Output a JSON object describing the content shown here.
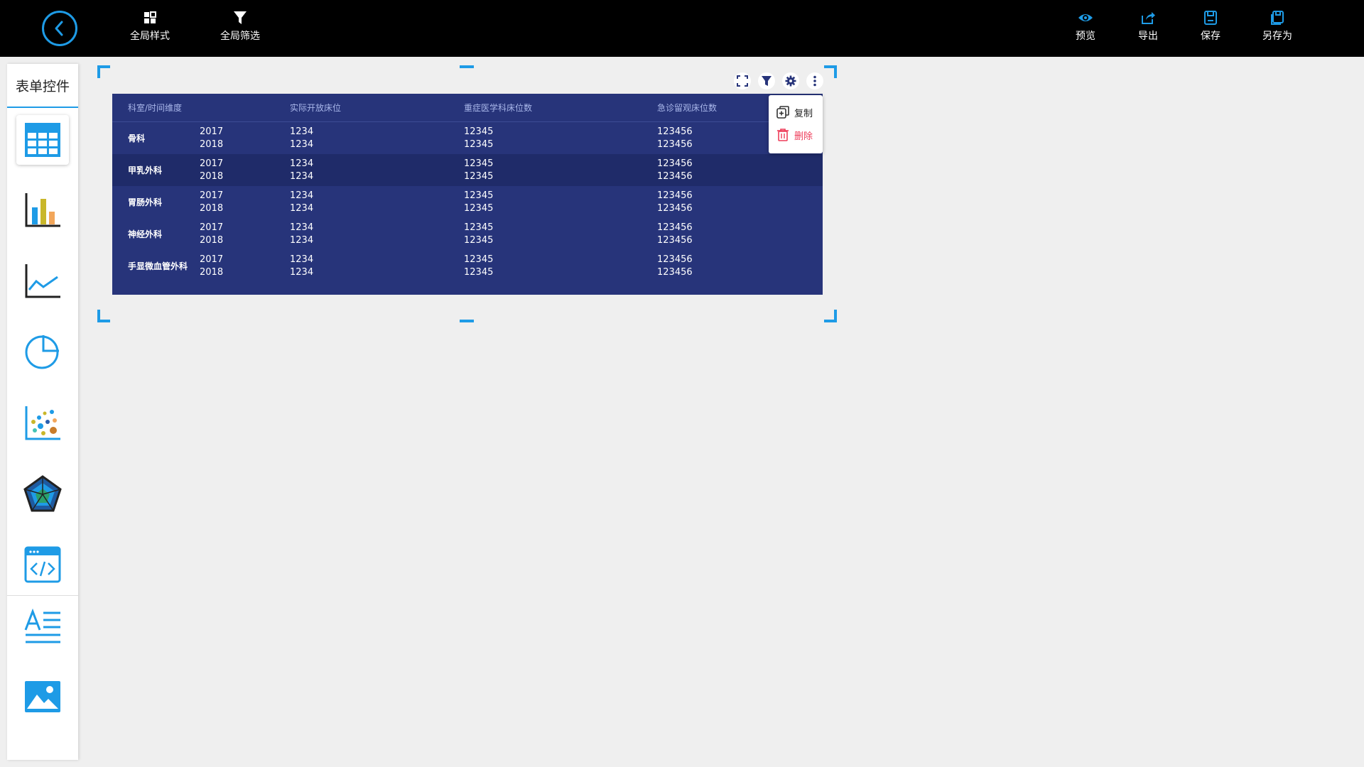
{
  "toolbar": {
    "left_tools": [
      {
        "label": "全局样式",
        "icon": "grid-icon"
      },
      {
        "label": "全局筛选",
        "icon": "filter-icon"
      }
    ],
    "right_tools": [
      {
        "label": "预览",
        "icon": "eye-icon"
      },
      {
        "label": "导出",
        "icon": "export-icon"
      },
      {
        "label": "保存",
        "icon": "save-icon"
      },
      {
        "label": "另存为",
        "icon": "save-as-icon"
      }
    ]
  },
  "sidebar": {
    "title": "表单控件",
    "items": [
      {
        "name": "table",
        "icon": "table-icon"
      },
      {
        "name": "bar-chart",
        "icon": "bar-chart-icon"
      },
      {
        "name": "line-chart",
        "icon": "line-chart-icon"
      },
      {
        "name": "pie-chart",
        "icon": "pie-chart-icon"
      },
      {
        "name": "scatter-chart",
        "icon": "scatter-chart-icon"
      },
      {
        "name": "radar-chart",
        "icon": "radar-chart-icon"
      },
      {
        "name": "code-embed",
        "icon": "code-icon"
      },
      {
        "name": "text",
        "icon": "text-icon"
      },
      {
        "name": "image",
        "icon": "image-icon"
      }
    ]
  },
  "table": {
    "headers": [
      "科室/时间维度",
      "实际开放床位",
      "重症医学科床位数",
      "急诊留观床位数"
    ],
    "rows": [
      {
        "dept": "骨科",
        "years": [
          "2017",
          "2018"
        ],
        "a": [
          "1234",
          "1234"
        ],
        "b": [
          "12345",
          "12345"
        ],
        "c": [
          "123456",
          "123456"
        ]
      },
      {
        "dept": "甲乳外科",
        "years": [
          "2017",
          "2018"
        ],
        "a": [
          "1234",
          "1234"
        ],
        "b": [
          "12345",
          "12345"
        ],
        "c": [
          "123456",
          "123456"
        ]
      },
      {
        "dept": "胃肠外科",
        "years": [
          "2017",
          "2018"
        ],
        "a": [
          "1234",
          "1234"
        ],
        "b": [
          "12345",
          "12345"
        ],
        "c": [
          "123456",
          "123456"
        ]
      },
      {
        "dept": "神经外科",
        "years": [
          "2017",
          "2018"
        ],
        "a": [
          "1234",
          "1234"
        ],
        "b": [
          "12345",
          "12345"
        ],
        "c": [
          "123456",
          "123456"
        ]
      },
      {
        "dept": "手显微血管外科",
        "years": [
          "2017",
          "2018"
        ],
        "a": [
          "1234",
          "1234"
        ],
        "b": [
          "12345",
          "12345"
        ],
        "c": [
          "123456",
          "123456"
        ]
      }
    ]
  },
  "context_menu": {
    "copy": "复制",
    "delete": "删除"
  },
  "colors": {
    "accent": "#1e9be6",
    "table_bg": "#27347a",
    "table_alt_row": "#1f2b69",
    "delete": "#ee3d5a"
  }
}
